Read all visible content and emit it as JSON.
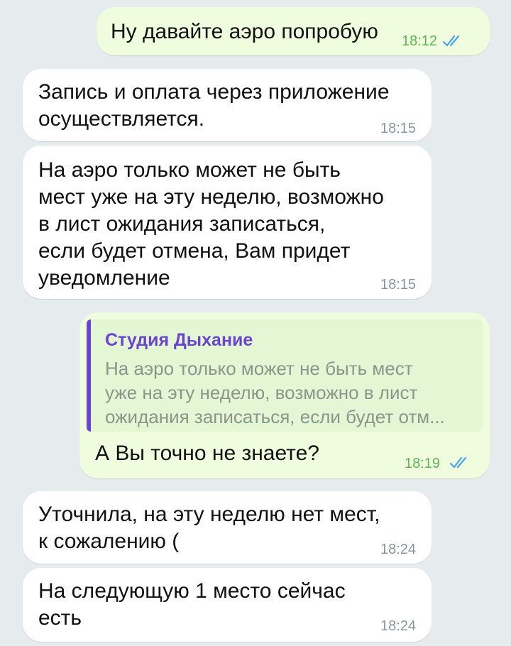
{
  "messages": [
    {
      "direction": "outgoing",
      "text": "Ну давайте аэро попробую",
      "time": "18:12",
      "status": "read-double-check-icon"
    },
    {
      "direction": "incoming",
      "text": "Запись и оплата через приложение\nосуществляется.",
      "time": "18:15"
    },
    {
      "direction": "incoming",
      "text": "На аэро только может не быть\nмест уже на эту неделю, возможно\nв лист ожидания записаться,\nесли будет отмена, Вам придет\nуведомление",
      "time": "18:15"
    },
    {
      "direction": "outgoing",
      "reply": {
        "author": "Студия Дыхание",
        "text": "На аэро только может не быть мест\nуже на эту неделю, возможно в лист\nожидания записаться, если будет отм..."
      },
      "text": "А Вы точно не знаете?",
      "time": "18:19",
      "status": "read-double-check-icon"
    },
    {
      "direction": "incoming",
      "text": "Уточнила, на эту неделю нет мест,\nк сожалению (",
      "time": "18:24"
    },
    {
      "direction": "incoming",
      "text": "На следующую 1 место сейчас\nесть",
      "time": "18:24"
    }
  ],
  "colors": {
    "background": "#e6ebee",
    "incoming_bubble": "#ffffff",
    "outgoing_bubble": "#effdde",
    "outgoing_time": "#5fb655",
    "read_check": "#4aa3e8",
    "quote_accent": "#6a44cf"
  }
}
